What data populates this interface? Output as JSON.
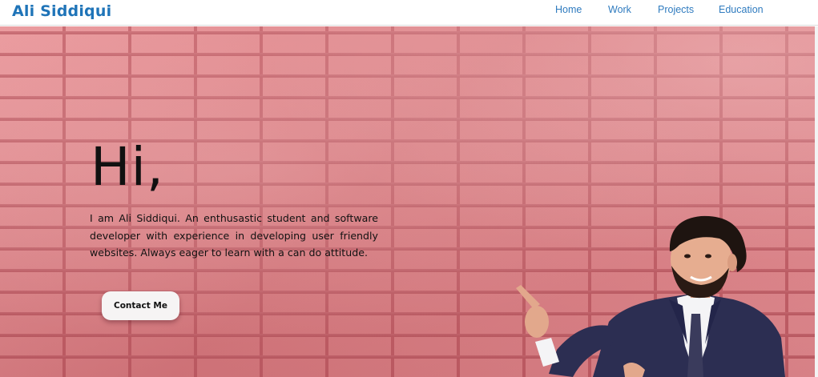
{
  "navbar": {
    "brand": "Ali Siddiqui",
    "links": [
      "Home",
      "Work",
      "Projects",
      "Education"
    ]
  },
  "hero": {
    "heading": "Hi,",
    "intro": "I am Ali Siddiqui. An enthusastic student and software developer with experience in developing user friendly websites. Always eager to learn with a can do attitude.",
    "cta_label": "Contact Me"
  },
  "colors": {
    "brand": "#1f74b8",
    "nav_link": "#2f7bbf",
    "brick": "#e0868a",
    "mortar": "#c35f67",
    "button_bg": "#f6f4f4",
    "text": "#111111"
  }
}
